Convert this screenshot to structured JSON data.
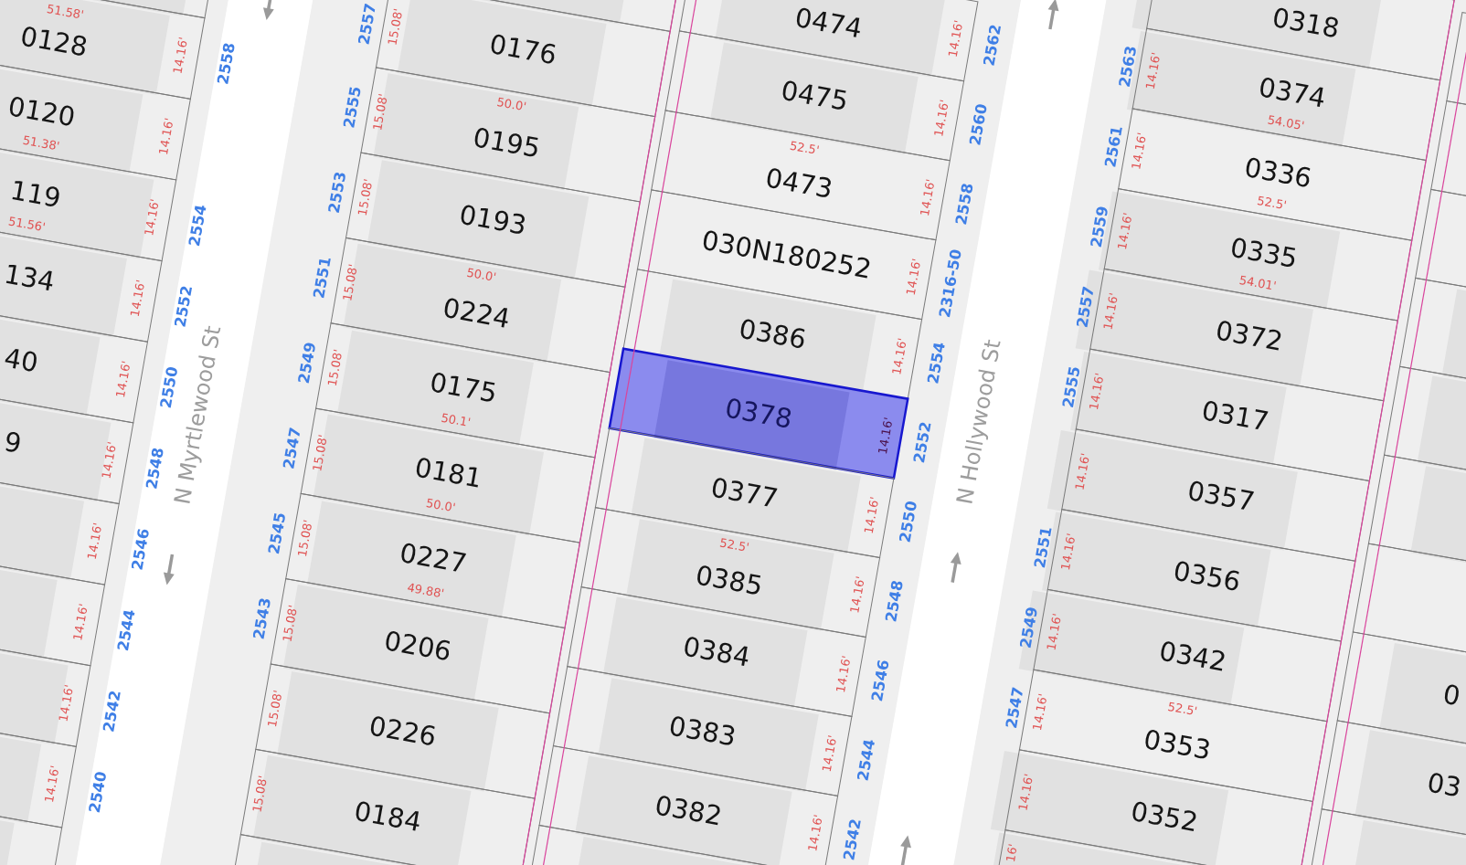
{
  "streets": [
    {
      "name": "N Myrtlewood St",
      "kind": "southbound"
    },
    {
      "name": "N Hollywood St",
      "kind": "northbound"
    }
  ],
  "blocks": [
    {
      "parcels": [
        {
          "selected": false,
          "building": true
        },
        {
          "label": "0128",
          "address": "2558",
          "frontage": "14.16'",
          "depth_above": "51.58'",
          "selected": false,
          "building": true
        },
        {
          "label": "0120",
          "frontage": "14.16'",
          "depth_below": "51.38'",
          "selected": false,
          "building": true
        },
        {
          "label": "119",
          "address": "2554",
          "frontage": "14.16'",
          "depth_below": "51.56'",
          "selected": false,
          "building": true
        },
        {
          "label": "134",
          "address": "2552",
          "frontage": "14.16'",
          "selected": false,
          "building": true
        },
        {
          "label": "40",
          "address": "2550",
          "frontage": "14.16'",
          "selected": false,
          "building": true
        },
        {
          "label": "9",
          "address": "2548",
          "frontage": "14.16'",
          "selected": false,
          "building": true
        },
        {
          "address": "2546",
          "frontage": "14.16'",
          "selected": false,
          "building": true
        },
        {
          "address": "2544",
          "frontage": "14.16'",
          "selected": false,
          "building": true
        },
        {
          "address": "2542",
          "frontage": "14.16'",
          "selected": false,
          "building": true
        },
        {
          "address": "2540",
          "frontage": "14.16'",
          "selected": false,
          "building": true
        },
        {
          "selected": false,
          "building": true
        }
      ]
    },
    {
      "parcels": [
        {
          "selected": false,
          "building": true
        },
        {
          "label": "0176",
          "address": "2557",
          "frontage": "15.08'",
          "selected": false,
          "building": true
        },
        {
          "label": "0195",
          "address": "2555",
          "frontage": "15.08'",
          "depth_above": "50.0'",
          "selected": false,
          "building": true
        },
        {
          "label": "0193",
          "address": "2553",
          "frontage": "15.08'",
          "selected": false,
          "building": true
        },
        {
          "label": "0224",
          "address": "2551",
          "frontage": "15.08'",
          "depth_above": "50.0'",
          "selected": false,
          "building": true
        },
        {
          "label": "0175",
          "address": "2549",
          "frontage": "15.08'",
          "depth_below": "50.1'",
          "selected": false,
          "building": true
        },
        {
          "label": "0181",
          "address": "2547",
          "frontage": "15.08'",
          "depth_below": "50.0'",
          "selected": false,
          "building": true
        },
        {
          "label": "0227",
          "address": "2545",
          "frontage": "15.08'",
          "depth_below": "49.88'",
          "selected": false,
          "building": true
        },
        {
          "label": "0206",
          "address": "2543",
          "frontage": "15.08'",
          "selected": false,
          "building": true
        },
        {
          "label": "0226",
          "frontage": "15.08'",
          "selected": false,
          "building": true
        },
        {
          "label": "0184",
          "frontage": "15.08'",
          "selected": false,
          "building": true
        },
        {
          "selected": false,
          "building": true
        }
      ]
    },
    {
      "parcels": [
        {
          "label": "0474",
          "address": "2562",
          "frontage": "14.16'",
          "selected": false,
          "building": true
        },
        {
          "label": "0475",
          "address": "2560",
          "frontage": "14.16'",
          "selected": false,
          "building": true
        },
        {
          "label": "0473",
          "address": "2558",
          "frontage": "14.16'",
          "depth_above": "52.5'",
          "selected": false,
          "building": false
        },
        {
          "label": "030N180252",
          "address": "2316-50",
          "frontage": "14.16'",
          "selected": false,
          "building": false
        },
        {
          "label": "0386",
          "address": "2554",
          "frontage": "14.16'",
          "selected": false,
          "building": true
        },
        {
          "label": "0378",
          "address": "2552",
          "frontage": "14.16'",
          "selected": true,
          "building": true
        },
        {
          "label": "0377",
          "address": "2550",
          "frontage": "14.16'",
          "selected": false,
          "building": true
        },
        {
          "label": "0385",
          "address": "2548",
          "frontage": "14.16'",
          "depth_above": "52.5'",
          "selected": false,
          "building": true
        },
        {
          "label": "0384",
          "address": "2546",
          "frontage": "14.16'",
          "selected": false,
          "building": true
        },
        {
          "label": "0383",
          "address": "2544",
          "frontage": "14.16'",
          "selected": false,
          "building": true
        },
        {
          "label": "0382",
          "address": "2542",
          "frontage": "14.16'",
          "selected": false,
          "building": true
        },
        {
          "selected": false,
          "building": true
        }
      ]
    },
    {
      "parcels": [
        {
          "label": "0318",
          "selected": false,
          "building": true
        },
        {
          "label": "0374",
          "address": "2563",
          "frontage": "14.16'",
          "depth_below": "54.05'",
          "selected": false,
          "building": true
        },
        {
          "label": "0336",
          "address": "2561",
          "frontage": "14.16'",
          "depth_below": "52.5'",
          "selected": false,
          "building": false
        },
        {
          "label": "0335",
          "address": "2559",
          "frontage": "14.16'",
          "depth_below": "54.01'",
          "selected": false,
          "building": true
        },
        {
          "label": "0372",
          "address": "2557",
          "frontage": "14.16'",
          "selected": false,
          "building": true
        },
        {
          "label": "0317",
          "address": "2555",
          "frontage": "14.16'",
          "selected": false,
          "building": true
        },
        {
          "label": "0357",
          "frontage": "14.16'",
          "selected": false,
          "building": true
        },
        {
          "label": "0356",
          "address": "2551",
          "frontage": "14.16'",
          "selected": false,
          "building": true
        },
        {
          "label": "0342",
          "address": "2549",
          "frontage": "14.16'",
          "selected": false,
          "building": true
        },
        {
          "label": "0353",
          "address": "2547",
          "frontage": "14.16'",
          "depth_above": "52.5'",
          "selected": false,
          "building": false
        },
        {
          "label": "0352",
          "frontage": "14.16'",
          "selected": false,
          "building": true
        },
        {
          "frontage": "16'",
          "selected": false,
          "building": true
        }
      ]
    },
    {
      "parcels": [
        {
          "selected": false,
          "building": false
        },
        {
          "selected": false,
          "building": false
        },
        {
          "selected": false,
          "building": false
        },
        {
          "selected": false,
          "building": true
        },
        {
          "selected": false,
          "building": true
        },
        {
          "selected": false,
          "building": true
        },
        {
          "selected": false,
          "building": false
        },
        {
          "label": "0",
          "selected": false,
          "building": true
        },
        {
          "label": "03",
          "selected": false,
          "building": true
        },
        {
          "selected": false,
          "building": true
        }
      ]
    }
  ]
}
